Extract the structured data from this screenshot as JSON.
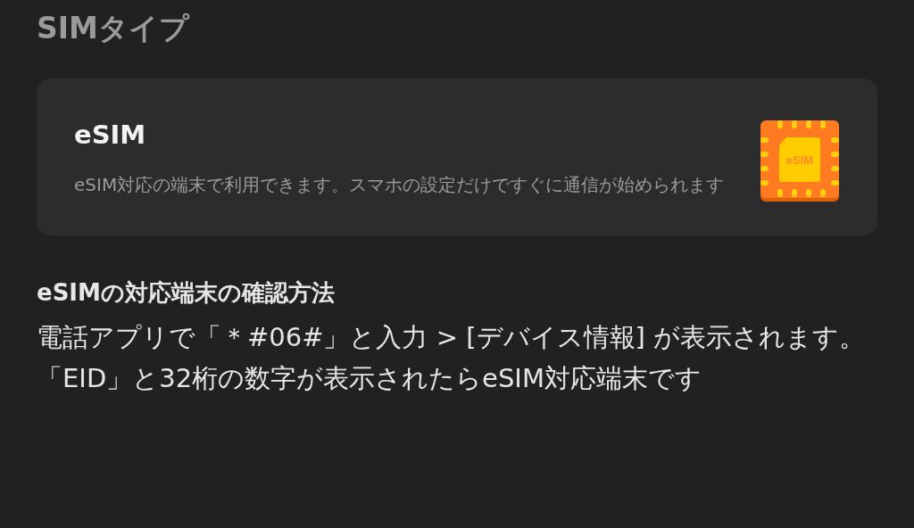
{
  "section_title": "SIMタイプ",
  "option": {
    "title": "eSIM",
    "description": "eSIM対応の端末で利用できます。スマホの設定だけですぐに通信が始められます",
    "icon_label": "eSIM"
  },
  "help": {
    "title": "eSIMの対応端末の確認方法",
    "body": "電話アプリで「＊#06#」と入力 > [デバイス情報] が表示されます。「EID」と32桁の数字が表示されたらeSIM対応端末です"
  }
}
